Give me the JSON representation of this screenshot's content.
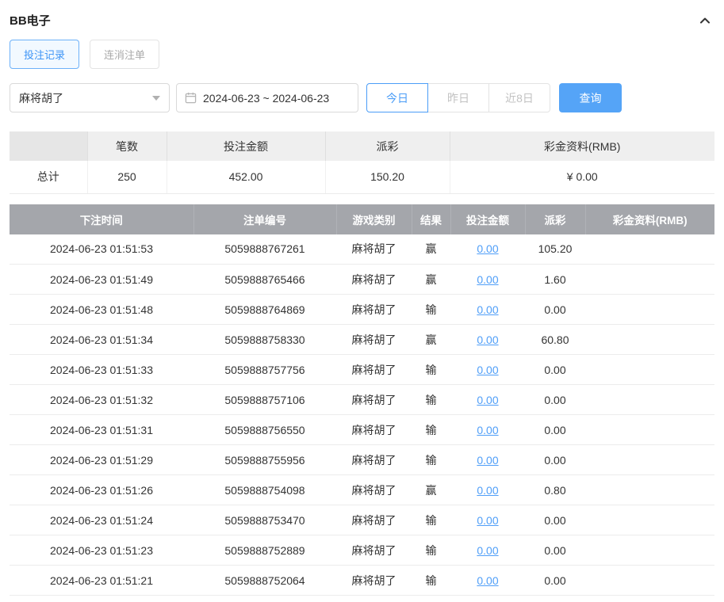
{
  "colors": {
    "accent_blue": "#4b9df7",
    "search_button_blue": "#55a4f7",
    "table_header_gray": "#a4a6ab"
  },
  "header": {
    "title": "BB电子"
  },
  "tabs": [
    {
      "label": "投注记录",
      "active": true
    },
    {
      "label": "连消注单",
      "active": false
    }
  ],
  "filters": {
    "game_select": {
      "value": "麻将胡了"
    },
    "date_range": {
      "value": "2024-06-23 ~ 2024-06-23"
    },
    "quick_buttons": [
      {
        "label": "今日",
        "active": true
      },
      {
        "label": "昨日",
        "active": false
      },
      {
        "label": "近8日",
        "active": false
      }
    ],
    "search_label": "查询"
  },
  "summary": {
    "headers": [
      "",
      "笔数",
      "投注金额",
      "派彩",
      "彩金资料(RMB)"
    ],
    "row_label": "总计",
    "count": "250",
    "bet_amount": "452.00",
    "payout": "150.20",
    "bonus": "¥ 0.00"
  },
  "table": {
    "headers": [
      "下注时间",
      "注单编号",
      "游戏类别",
      "结果",
      "投注金额",
      "派彩",
      "彩金资料(RMB)"
    ],
    "rows": [
      {
        "time": "2024-06-23 01:51:53",
        "order_id": "5059888767261",
        "game": "麻将胡了",
        "result": "赢",
        "bet": "0.00",
        "payout": "105.20",
        "bonus": ""
      },
      {
        "time": "2024-06-23 01:51:49",
        "order_id": "5059888765466",
        "game": "麻将胡了",
        "result": "赢",
        "bet": "0.00",
        "payout": "1.60",
        "bonus": ""
      },
      {
        "time": "2024-06-23 01:51:48",
        "order_id": "5059888764869",
        "game": "麻将胡了",
        "result": "输",
        "bet": "0.00",
        "payout": "0.00",
        "bonus": ""
      },
      {
        "time": "2024-06-23 01:51:34",
        "order_id": "5059888758330",
        "game": "麻将胡了",
        "result": "赢",
        "bet": "0.00",
        "payout": "60.80",
        "bonus": ""
      },
      {
        "time": "2024-06-23 01:51:33",
        "order_id": "5059888757756",
        "game": "麻将胡了",
        "result": "输",
        "bet": "0.00",
        "payout": "0.00",
        "bonus": ""
      },
      {
        "time": "2024-06-23 01:51:32",
        "order_id": "5059888757106",
        "game": "麻将胡了",
        "result": "输",
        "bet": "0.00",
        "payout": "0.00",
        "bonus": ""
      },
      {
        "time": "2024-06-23 01:51:31",
        "order_id": "5059888756550",
        "game": "麻将胡了",
        "result": "输",
        "bet": "0.00",
        "payout": "0.00",
        "bonus": ""
      },
      {
        "time": "2024-06-23 01:51:29",
        "order_id": "5059888755956",
        "game": "麻将胡了",
        "result": "输",
        "bet": "0.00",
        "payout": "0.00",
        "bonus": ""
      },
      {
        "time": "2024-06-23 01:51:26",
        "order_id": "5059888754098",
        "game": "麻将胡了",
        "result": "赢",
        "bet": "0.00",
        "payout": "0.80",
        "bonus": ""
      },
      {
        "time": "2024-06-23 01:51:24",
        "order_id": "5059888753470",
        "game": "麻将胡了",
        "result": "输",
        "bet": "0.00",
        "payout": "0.00",
        "bonus": ""
      },
      {
        "time": "2024-06-23 01:51:23",
        "order_id": "5059888752889",
        "game": "麻将胡了",
        "result": "输",
        "bet": "0.00",
        "payout": "0.00",
        "bonus": ""
      },
      {
        "time": "2024-06-23 01:51:21",
        "order_id": "5059888752064",
        "game": "麻将胡了",
        "result": "输",
        "bet": "0.00",
        "payout": "0.00",
        "bonus": ""
      }
    ]
  }
}
